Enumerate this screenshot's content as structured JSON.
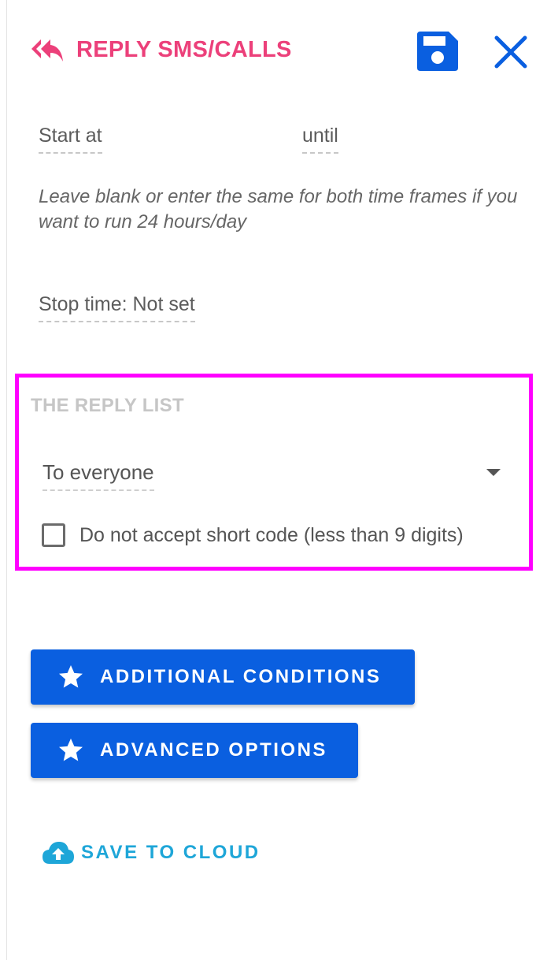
{
  "header": {
    "title": "REPLY SMS/CALLS",
    "back_icon": "reply-all-icon",
    "save_icon": "floppy-disk-icon",
    "close_icon": "close-icon",
    "title_color": "#ec407a"
  },
  "schedule": {
    "start_label": "Start at",
    "until_label": "until",
    "hint": "Leave blank or enter the same for both time frames if you want to run 24 hours/day",
    "stop_time_label": "Stop time: Not set"
  },
  "reply_list": {
    "section_title": "THE REPLY LIST",
    "selected_option": "To everyone",
    "short_code_checkbox": {
      "label": "Do not accept short code (less than 9 digits)",
      "checked": false
    },
    "highlight_color": "#ff00ff"
  },
  "buttons": {
    "additional_conditions": "ADDITIONAL CONDITIONS",
    "advanced_options": "ADVANCED OPTIONS",
    "button_icon": "star-icon",
    "button_color": "#0a5fe0"
  },
  "cloud": {
    "label": "SAVE TO CLOUD",
    "icon": "cloud-upload-icon",
    "color": "#1ea6d8"
  }
}
